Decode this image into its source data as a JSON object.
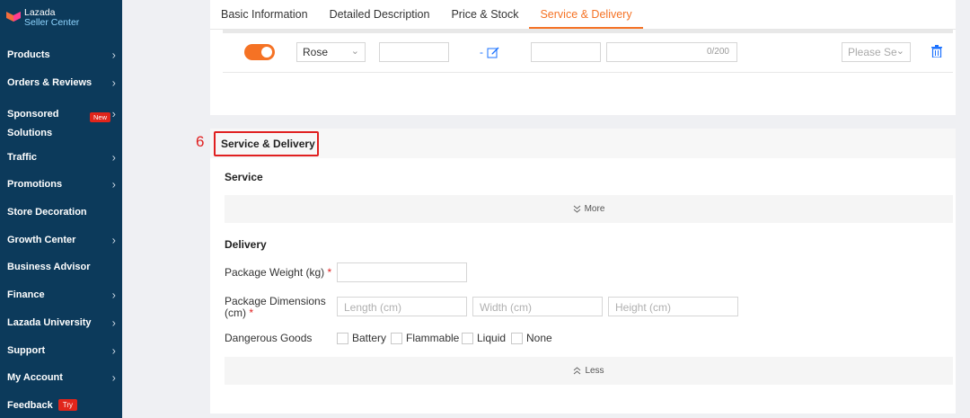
{
  "brand": {
    "line1": "Lazada",
    "line2": "Seller Center"
  },
  "sidebar": {
    "items": [
      {
        "label": "Products",
        "chevron": "›"
      },
      {
        "label": "Orders & Reviews",
        "chevron": "›"
      },
      {
        "label_line1": "Sponsored",
        "label_line2": "Solutions",
        "chevron": "›",
        "badge": "New"
      },
      {
        "label": "Traffic",
        "chevron": "›"
      },
      {
        "label": "Promotions",
        "chevron": "›"
      },
      {
        "label": "Store Decoration"
      },
      {
        "label": "Growth Center",
        "chevron": "›"
      },
      {
        "label": "Business Advisor"
      },
      {
        "label": "Finance",
        "chevron": "›"
      },
      {
        "label": "Lazada University",
        "chevron": "›"
      },
      {
        "label": "Support",
        "chevron": "›"
      },
      {
        "label": "My Account",
        "chevron": "›"
      },
      {
        "label": "Feedback",
        "badge": "Try"
      }
    ]
  },
  "tabs": [
    "Basic Information",
    "Detailed Description",
    "Price & Stock",
    "Service & Delivery"
  ],
  "active_tab": "Service & Delivery",
  "variant_row": {
    "toggle_on": true,
    "color_select": "Rose",
    "dash": "-",
    "counter": "0/200",
    "please_select": "Please Se"
  },
  "step_number": "6",
  "section": {
    "title": "Service & Delivery",
    "service_heading": "Service",
    "more_label": "More",
    "delivery_heading": "Delivery",
    "package_weight_label": "Package Weight (kg)",
    "package_dimensions_label_1": "Package Dimensions",
    "package_dimensions_label_2": "(cm)",
    "required_mark": "*",
    "length_placeholder": "Length (cm)",
    "width_placeholder": "Width (cm)",
    "height_placeholder": "Height (cm)",
    "dangerous_goods_label": "Dangerous Goods",
    "dangerous_goods_options": [
      "Battery",
      "Flammable",
      "Liquid",
      "None"
    ],
    "less_label": "Less"
  },
  "colors": {
    "accent": "#f57224",
    "sidebar_bg": "#0c3a5b",
    "highlight": "#e02020",
    "link_blue": "#1a71ff"
  },
  "icons": [
    "lazada-logo-icon",
    "chevron-right-icon",
    "chevron-down-icon",
    "edit-icon",
    "trash-icon",
    "double-chevron-down-icon",
    "double-chevron-up-icon"
  ]
}
